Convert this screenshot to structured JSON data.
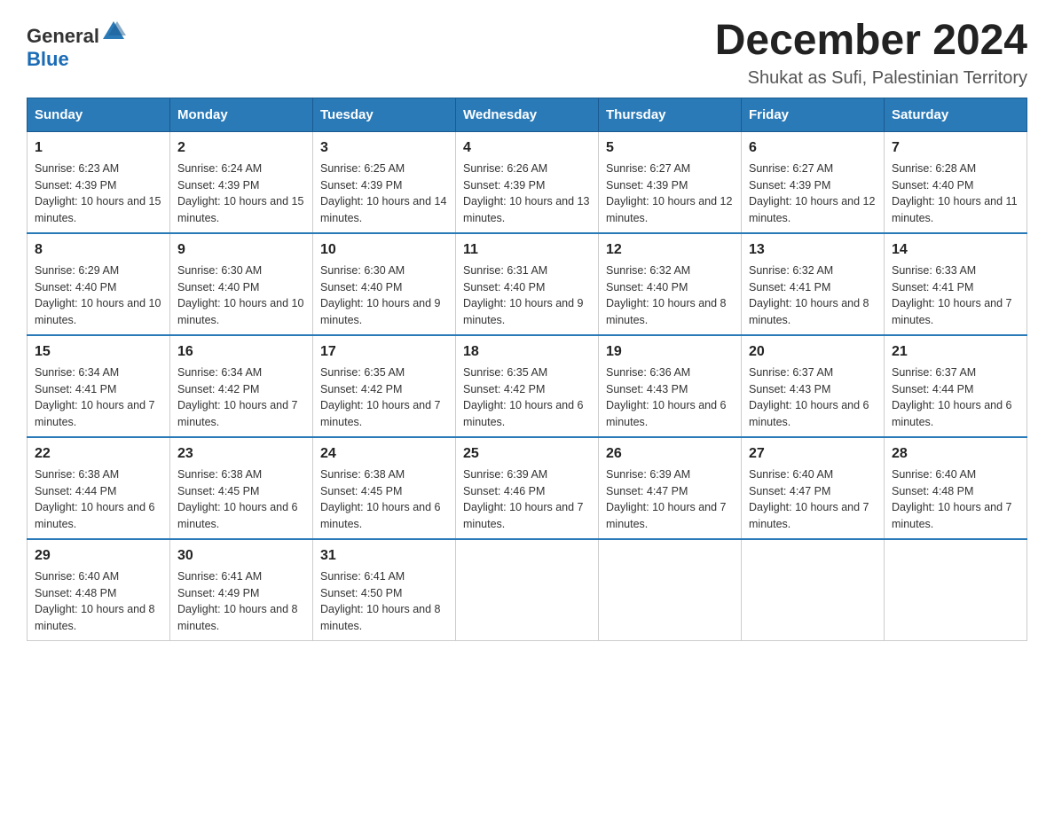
{
  "logo": {
    "text_general": "General",
    "text_blue": "Blue"
  },
  "header": {
    "month_title": "December 2024",
    "subtitle": "Shukat as Sufi, Palestinian Territory"
  },
  "days_of_week": [
    "Sunday",
    "Monday",
    "Tuesday",
    "Wednesday",
    "Thursday",
    "Friday",
    "Saturday"
  ],
  "weeks": [
    [
      {
        "day": "1",
        "sunrise": "Sunrise: 6:23 AM",
        "sunset": "Sunset: 4:39 PM",
        "daylight": "Daylight: 10 hours and 15 minutes."
      },
      {
        "day": "2",
        "sunrise": "Sunrise: 6:24 AM",
        "sunset": "Sunset: 4:39 PM",
        "daylight": "Daylight: 10 hours and 15 minutes."
      },
      {
        "day": "3",
        "sunrise": "Sunrise: 6:25 AM",
        "sunset": "Sunset: 4:39 PM",
        "daylight": "Daylight: 10 hours and 14 minutes."
      },
      {
        "day": "4",
        "sunrise": "Sunrise: 6:26 AM",
        "sunset": "Sunset: 4:39 PM",
        "daylight": "Daylight: 10 hours and 13 minutes."
      },
      {
        "day": "5",
        "sunrise": "Sunrise: 6:27 AM",
        "sunset": "Sunset: 4:39 PM",
        "daylight": "Daylight: 10 hours and 12 minutes."
      },
      {
        "day": "6",
        "sunrise": "Sunrise: 6:27 AM",
        "sunset": "Sunset: 4:39 PM",
        "daylight": "Daylight: 10 hours and 12 minutes."
      },
      {
        "day": "7",
        "sunrise": "Sunrise: 6:28 AM",
        "sunset": "Sunset: 4:40 PM",
        "daylight": "Daylight: 10 hours and 11 minutes."
      }
    ],
    [
      {
        "day": "8",
        "sunrise": "Sunrise: 6:29 AM",
        "sunset": "Sunset: 4:40 PM",
        "daylight": "Daylight: 10 hours and 10 minutes."
      },
      {
        "day": "9",
        "sunrise": "Sunrise: 6:30 AM",
        "sunset": "Sunset: 4:40 PM",
        "daylight": "Daylight: 10 hours and 10 minutes."
      },
      {
        "day": "10",
        "sunrise": "Sunrise: 6:30 AM",
        "sunset": "Sunset: 4:40 PM",
        "daylight": "Daylight: 10 hours and 9 minutes."
      },
      {
        "day": "11",
        "sunrise": "Sunrise: 6:31 AM",
        "sunset": "Sunset: 4:40 PM",
        "daylight": "Daylight: 10 hours and 9 minutes."
      },
      {
        "day": "12",
        "sunrise": "Sunrise: 6:32 AM",
        "sunset": "Sunset: 4:40 PM",
        "daylight": "Daylight: 10 hours and 8 minutes."
      },
      {
        "day": "13",
        "sunrise": "Sunrise: 6:32 AM",
        "sunset": "Sunset: 4:41 PM",
        "daylight": "Daylight: 10 hours and 8 minutes."
      },
      {
        "day": "14",
        "sunrise": "Sunrise: 6:33 AM",
        "sunset": "Sunset: 4:41 PM",
        "daylight": "Daylight: 10 hours and 7 minutes."
      }
    ],
    [
      {
        "day": "15",
        "sunrise": "Sunrise: 6:34 AM",
        "sunset": "Sunset: 4:41 PM",
        "daylight": "Daylight: 10 hours and 7 minutes."
      },
      {
        "day": "16",
        "sunrise": "Sunrise: 6:34 AM",
        "sunset": "Sunset: 4:42 PM",
        "daylight": "Daylight: 10 hours and 7 minutes."
      },
      {
        "day": "17",
        "sunrise": "Sunrise: 6:35 AM",
        "sunset": "Sunset: 4:42 PM",
        "daylight": "Daylight: 10 hours and 7 minutes."
      },
      {
        "day": "18",
        "sunrise": "Sunrise: 6:35 AM",
        "sunset": "Sunset: 4:42 PM",
        "daylight": "Daylight: 10 hours and 6 minutes."
      },
      {
        "day": "19",
        "sunrise": "Sunrise: 6:36 AM",
        "sunset": "Sunset: 4:43 PM",
        "daylight": "Daylight: 10 hours and 6 minutes."
      },
      {
        "day": "20",
        "sunrise": "Sunrise: 6:37 AM",
        "sunset": "Sunset: 4:43 PM",
        "daylight": "Daylight: 10 hours and 6 minutes."
      },
      {
        "day": "21",
        "sunrise": "Sunrise: 6:37 AM",
        "sunset": "Sunset: 4:44 PM",
        "daylight": "Daylight: 10 hours and 6 minutes."
      }
    ],
    [
      {
        "day": "22",
        "sunrise": "Sunrise: 6:38 AM",
        "sunset": "Sunset: 4:44 PM",
        "daylight": "Daylight: 10 hours and 6 minutes."
      },
      {
        "day": "23",
        "sunrise": "Sunrise: 6:38 AM",
        "sunset": "Sunset: 4:45 PM",
        "daylight": "Daylight: 10 hours and 6 minutes."
      },
      {
        "day": "24",
        "sunrise": "Sunrise: 6:38 AM",
        "sunset": "Sunset: 4:45 PM",
        "daylight": "Daylight: 10 hours and 6 minutes."
      },
      {
        "day": "25",
        "sunrise": "Sunrise: 6:39 AM",
        "sunset": "Sunset: 4:46 PM",
        "daylight": "Daylight: 10 hours and 7 minutes."
      },
      {
        "day": "26",
        "sunrise": "Sunrise: 6:39 AM",
        "sunset": "Sunset: 4:47 PM",
        "daylight": "Daylight: 10 hours and 7 minutes."
      },
      {
        "day": "27",
        "sunrise": "Sunrise: 6:40 AM",
        "sunset": "Sunset: 4:47 PM",
        "daylight": "Daylight: 10 hours and 7 minutes."
      },
      {
        "day": "28",
        "sunrise": "Sunrise: 6:40 AM",
        "sunset": "Sunset: 4:48 PM",
        "daylight": "Daylight: 10 hours and 7 minutes."
      }
    ],
    [
      {
        "day": "29",
        "sunrise": "Sunrise: 6:40 AM",
        "sunset": "Sunset: 4:48 PM",
        "daylight": "Daylight: 10 hours and 8 minutes."
      },
      {
        "day": "30",
        "sunrise": "Sunrise: 6:41 AM",
        "sunset": "Sunset: 4:49 PM",
        "daylight": "Daylight: 10 hours and 8 minutes."
      },
      {
        "day": "31",
        "sunrise": "Sunrise: 6:41 AM",
        "sunset": "Sunset: 4:50 PM",
        "daylight": "Daylight: 10 hours and 8 minutes."
      },
      null,
      null,
      null,
      null
    ]
  ]
}
